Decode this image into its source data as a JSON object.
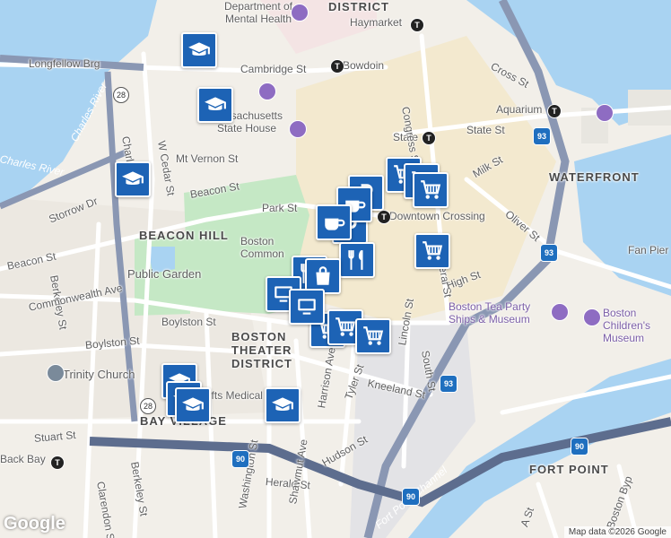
{
  "map": {
    "attribution": "Map data ©2026 Google",
    "logo": "Google",
    "colors": {
      "water": "#a9d3f2",
      "land": "#f2efe9",
      "park": "#c5e8c5",
      "highway": "#5d6d8e",
      "marker": "#1d63b5"
    },
    "labels": {
      "department_mental_health": "Department of Mental Health",
      "district_top": "DISTRICT",
      "haymarket": "Haymarket",
      "longfellow": "Longfellow Brg",
      "cambridge_st": "Cambridge St",
      "bowdoin": "Bowdoin",
      "cross_st": "Cross St",
      "charles_river": "Charles River",
      "massachusetts_state_house": "Massachusetts State House",
      "w_cedar_st": "W Cedar St",
      "charles_st": "Charles St",
      "aquarium": "Aquarium",
      "state_st": "State St",
      "state": "State",
      "congress_st": "Congress St",
      "mt_vernon_st": "Mt Vernon St",
      "milk_st": "Milk St",
      "waterfront": "WATERFRONT",
      "beacon_st_top": "Beacon St",
      "storrow_dr": "Storrow Dr",
      "park_st": "Park St",
      "downtown_crossing": "Downtown Crossing",
      "oliver_st": "Oliver St",
      "beacon_hill": "BEACON HILL",
      "boston_common": "Boston Common",
      "fan_pier": "Fan Pier",
      "beacon_st_left": "Beacon St",
      "berkeley_st": "Berkeley St",
      "public_garden": "Public Garden",
      "federal_st": "Federal St",
      "high_st": "High St",
      "commonwealth_ave": "Commonwealth Ave",
      "tea_party": "Boston Tea Party Ships & Museum",
      "childrens_museum": "Boston Children's Museum",
      "boylston_st_top": "Boylston St",
      "boylston_st_left": "Boylston St",
      "theater_district": "BOSTON THEATER DISTRICT",
      "lincoln_st": "Lincoln St",
      "south_st": "South St",
      "trinity_church": "Trinity Church",
      "tufts_medical": "Tufts Medical Center",
      "kneeland_st": "Kneeland St",
      "harrison_ave": "Harrison Ave",
      "tyler_st": "Tyler St",
      "bay_village": "BAY VILLAGE",
      "stuart_st": "Stuart St",
      "back_bay": "Back Bay",
      "fort_point": "FORT POINT",
      "hudson_st": "Hudson St",
      "herald_st": "Herald St",
      "clarendon_st": "Clarendon St",
      "berkeley_st_bottom": "Berkeley St",
      "shawmut_ave": "Shawmut Ave",
      "washington_st": "Washington St",
      "fort_point_channel": "Fort Point Channel",
      "a_st": "A St",
      "boston_byp": "Boston Byp"
    },
    "highway_shields": [
      "93",
      "93",
      "93",
      "90",
      "90",
      "90",
      "28",
      "28"
    ],
    "markers": [
      {
        "type": "school",
        "icon": "graduation-cap-icon"
      },
      {
        "type": "school",
        "icon": "graduation-cap-icon"
      },
      {
        "type": "school",
        "icon": "graduation-cap-icon"
      },
      {
        "type": "school",
        "icon": "graduation-cap-icon"
      },
      {
        "type": "school",
        "icon": "graduation-cap-icon"
      },
      {
        "type": "school",
        "icon": "graduation-cap-icon"
      },
      {
        "type": "school",
        "icon": "graduation-cap-icon"
      },
      {
        "type": "grocery",
        "icon": "shopping-cart-icon"
      },
      {
        "type": "grocery",
        "icon": "shopping-cart-icon"
      },
      {
        "type": "grocery",
        "icon": "shopping-cart-icon"
      },
      {
        "type": "grocery",
        "icon": "shopping-cart-icon"
      },
      {
        "type": "grocery",
        "icon": "shopping-cart-icon"
      },
      {
        "type": "grocery",
        "icon": "shopping-cart-icon"
      },
      {
        "type": "grocery",
        "icon": "shopping-cart-icon"
      },
      {
        "type": "parking",
        "icon": "parking-icon"
      },
      {
        "type": "parking",
        "icon": "parking-icon"
      },
      {
        "type": "cafe",
        "icon": "coffee-icon"
      },
      {
        "type": "cafe",
        "icon": "coffee-icon"
      },
      {
        "type": "restaurant",
        "icon": "fork-knife-icon"
      },
      {
        "type": "restaurant",
        "icon": "fork-knife-icon"
      },
      {
        "type": "shopping",
        "icon": "shopping-bag-icon"
      },
      {
        "type": "library",
        "icon": "computer-icon"
      },
      {
        "type": "library",
        "icon": "computer-icon"
      }
    ]
  }
}
